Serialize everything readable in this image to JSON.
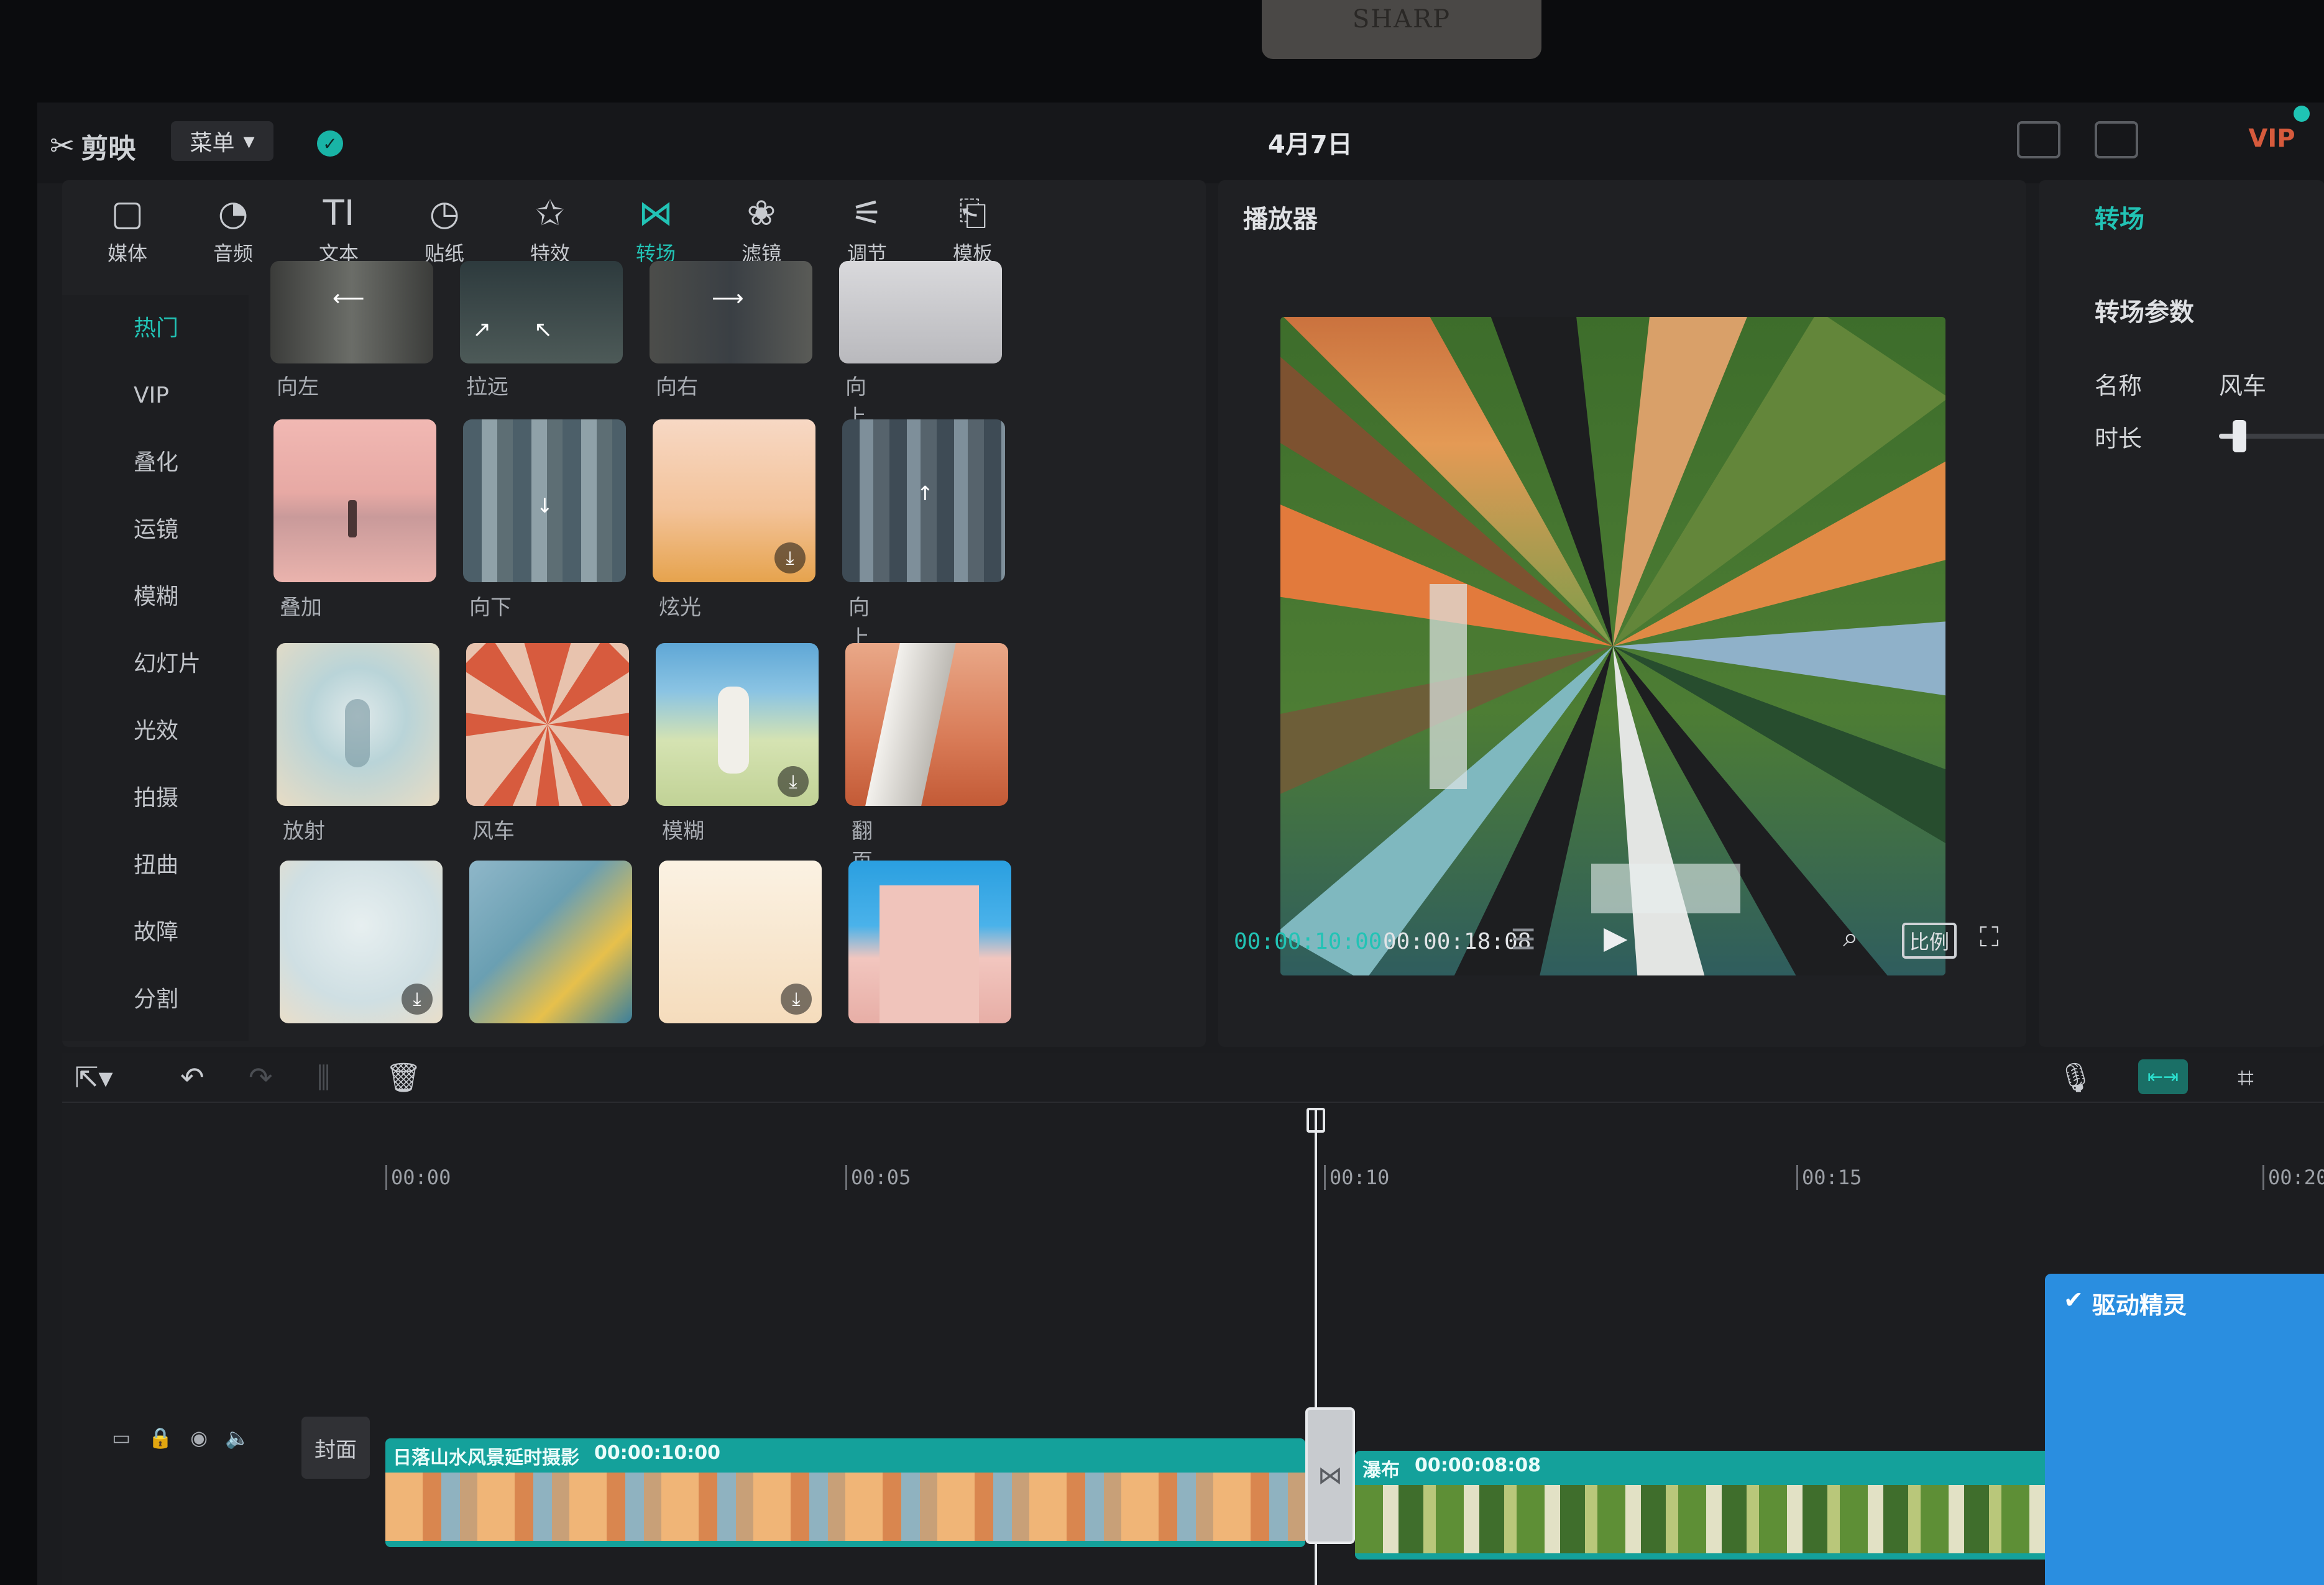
{
  "app": {
    "logo_text": "剪映",
    "menu_label": "菜单",
    "document_title": "4月7日",
    "vip_label": "VIP",
    "stand_text": "SHARP"
  },
  "toolbar_tabs": [
    {
      "icon": "media-icon",
      "glyph": "▢",
      "label": "媒体"
    },
    {
      "icon": "audio-icon",
      "glyph": "◔",
      "label": "音频"
    },
    {
      "icon": "text-icon",
      "glyph": "TI",
      "label": "文本"
    },
    {
      "icon": "sticker-icon",
      "glyph": "◷",
      "label": "贴纸"
    },
    {
      "icon": "effects-icon",
      "glyph": "✩",
      "label": "特效"
    },
    {
      "icon": "transition-icon",
      "glyph": "⋈",
      "label": "转场",
      "active": true
    },
    {
      "icon": "filter-icon",
      "glyph": "❀",
      "label": "滤镜"
    },
    {
      "icon": "adjust-icon",
      "glyph": "⚟",
      "label": "调节"
    },
    {
      "icon": "template-icon",
      "glyph": "⎗",
      "label": "模板"
    }
  ],
  "categories": [
    {
      "label": "热门",
      "active": true
    },
    {
      "label": "VIP"
    },
    {
      "label": "叠化"
    },
    {
      "label": "运镜"
    },
    {
      "label": "模糊"
    },
    {
      "label": "幻灯片"
    },
    {
      "label": "光效"
    },
    {
      "label": "拍摄"
    },
    {
      "label": "扭曲"
    },
    {
      "label": "故障"
    },
    {
      "label": "分割"
    }
  ],
  "transition_tiles": {
    "row0": [
      "向左",
      "拉远",
      "向右",
      "向上"
    ],
    "row1": [
      "叠加",
      "向下",
      "炫光",
      "向上"
    ],
    "row2": [
      "放射",
      "风车",
      "模糊",
      "翻页"
    ]
  },
  "player": {
    "title": "播放器",
    "current_time": "00:00:10:00",
    "total_time": "00:00:18:08",
    "ratio_label": "比例"
  },
  "properties": {
    "tab": "转场",
    "section_title": "转场参数",
    "name_label": "名称",
    "name_value": "风车",
    "duration_label": "时长",
    "duration_fraction": 0.15
  },
  "timeline": {
    "ruler_labels": [
      "00:00",
      "00:05",
      "00:10",
      "00:15",
      "00:20"
    ],
    "cover_label": "封面",
    "clips": [
      {
        "name": "日落山水风景延时摄影",
        "duration": "00:00:10:00"
      },
      {
        "name": "瀑布",
        "duration": "00:00:08:08"
      }
    ]
  },
  "driver_popup": {
    "title": "驱动精灵"
  },
  "colors": {
    "accent": "#22c3b5",
    "clip": "#14a19b",
    "background": "#1b1c1f"
  }
}
